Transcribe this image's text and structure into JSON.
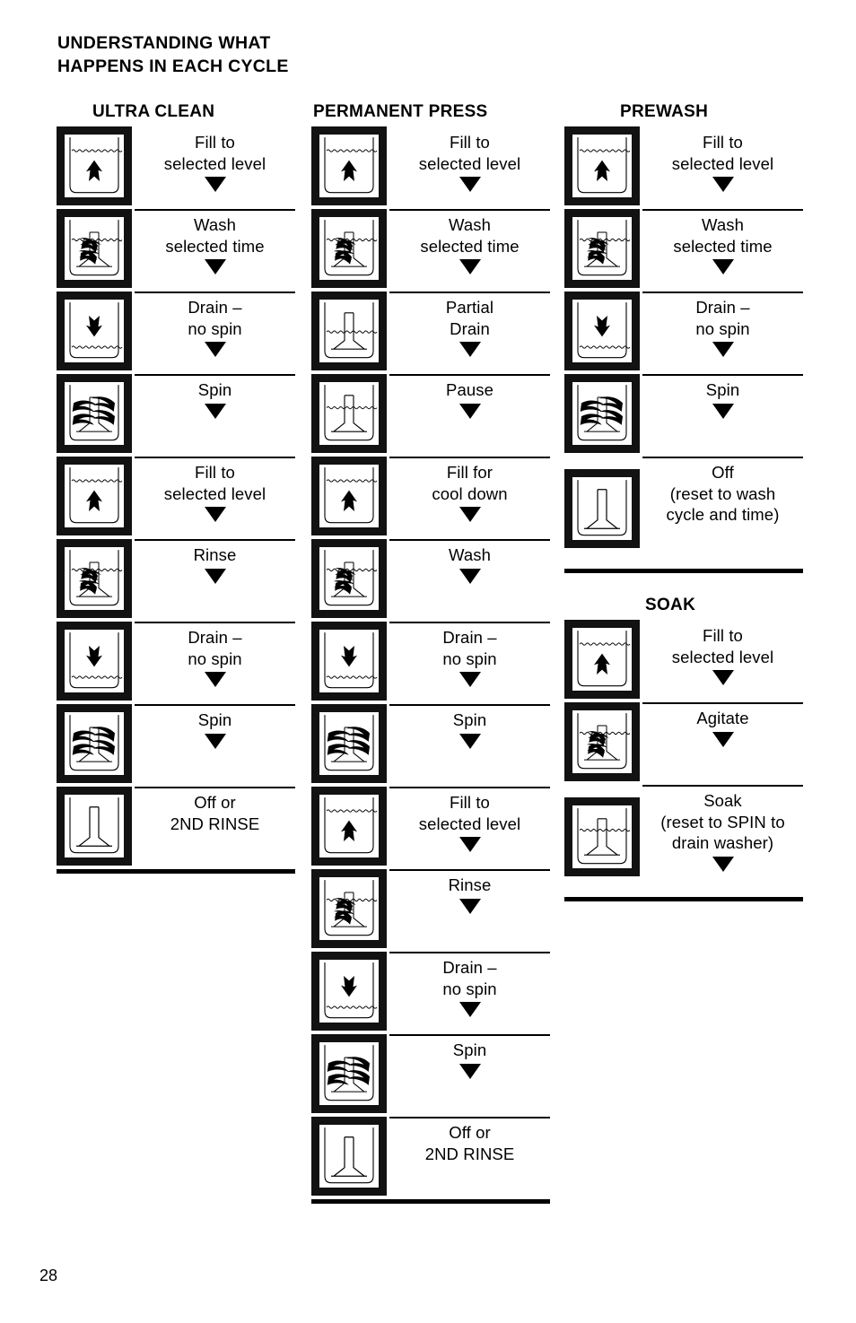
{
  "page": {
    "heading": "UNDERSTANDING WHAT\nHAPPENS IN EACH CYCLE",
    "number": "28",
    "ink_color": "#000000",
    "paper_color": "#ffffff"
  },
  "columns": [
    {
      "id": "ultra-clean",
      "title": "ULTRA CLEAN",
      "steps": [
        {
          "icon": "fill-water-up-arrow-icon",
          "label": "Fill to\nselected level",
          "arrow": true
        },
        {
          "icon": "agitate-wash-icon",
          "label": "Wash\nselected time",
          "arrow": true
        },
        {
          "icon": "drain-down-arrow-icon",
          "label": "Drain –\nno spin",
          "arrow": true
        },
        {
          "icon": "spin-icon",
          "label": "Spin",
          "arrow": true
        },
        {
          "icon": "fill-water-up-arrow-icon",
          "label": "Fill to\nselected level",
          "arrow": true
        },
        {
          "icon": "agitate-wash-icon",
          "label": "Rinse",
          "arrow": true
        },
        {
          "icon": "drain-down-arrow-icon",
          "label": "Drain –\nno spin",
          "arrow": true
        },
        {
          "icon": "spin-icon",
          "label": "Spin",
          "arrow": true
        },
        {
          "icon": "off-empty-tub-icon",
          "label": "Off or\n2ND RINSE",
          "arrow": false
        }
      ]
    },
    {
      "id": "permanent-press",
      "title": "PERMANENT PRESS",
      "steps": [
        {
          "icon": "fill-water-up-arrow-icon",
          "label": "Fill to\nselected level",
          "arrow": true
        },
        {
          "icon": "agitate-wash-icon",
          "label": "Wash\nselected time",
          "arrow": true
        },
        {
          "icon": "partial-drain-icon",
          "label": "Partial\nDrain",
          "arrow": true
        },
        {
          "icon": "pause-icon",
          "label": "Pause",
          "arrow": true
        },
        {
          "icon": "fill-water-up-arrow-icon",
          "label": "Fill for\ncool down",
          "arrow": true
        },
        {
          "icon": "agitate-wash-icon",
          "label": "Wash",
          "arrow": true
        },
        {
          "icon": "drain-down-arrow-icon",
          "label": "Drain –\nno spin",
          "arrow": true
        },
        {
          "icon": "spin-icon",
          "label": "Spin",
          "arrow": true
        },
        {
          "icon": "fill-water-up-arrow-icon",
          "label": "Fill to\nselected level",
          "arrow": true
        },
        {
          "icon": "agitate-wash-icon",
          "label": "Rinse",
          "arrow": true
        },
        {
          "icon": "drain-down-arrow-icon",
          "label": "Drain –\nno spin",
          "arrow": true
        },
        {
          "icon": "spin-icon",
          "label": "Spin",
          "arrow": true
        },
        {
          "icon": "off-empty-tub-icon",
          "label": "Off or\n2ND RINSE",
          "arrow": false
        }
      ]
    },
    {
      "id": "prewash",
      "title": "PREWASH",
      "steps": [
        {
          "icon": "fill-water-up-arrow-icon",
          "label": "Fill to\nselected level",
          "arrow": true
        },
        {
          "icon": "agitate-wash-icon",
          "label": "Wash\nselected time",
          "arrow": true
        },
        {
          "icon": "drain-down-arrow-icon",
          "label": "Drain –\nno spin",
          "arrow": true
        },
        {
          "icon": "spin-icon",
          "label": "Spin",
          "arrow": true
        },
        {
          "icon": "off-empty-tub-icon",
          "label": "Off\n(reset to wash\ncycle and time)",
          "arrow": false
        }
      ]
    },
    {
      "id": "soak",
      "title": "SOAK",
      "steps": [
        {
          "icon": "fill-water-up-arrow-icon",
          "label": "Fill to\nselected level",
          "arrow": true
        },
        {
          "icon": "agitate-wash-icon",
          "label": "Agitate",
          "arrow": true
        },
        {
          "icon": "soak-still-water-icon",
          "label": "Soak\n(reset to SPIN to\ndrain washer)",
          "arrow": true
        }
      ]
    }
  ]
}
